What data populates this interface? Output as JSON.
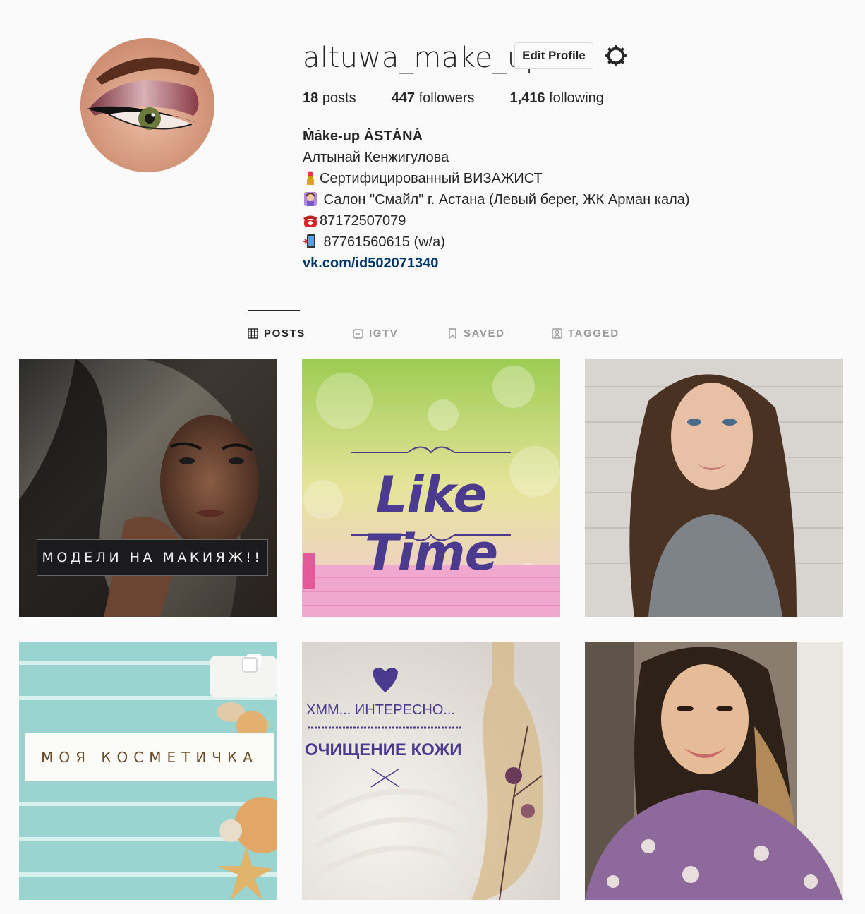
{
  "profile": {
    "username": "altuwa_make_up",
    "edit_label": "Edit Profile",
    "stats": {
      "posts_num": "18",
      "posts_label": "posts",
      "followers_num": "447",
      "followers_label": "followers",
      "following_num": "1,416",
      "following_label": "following"
    },
    "bio": {
      "name": "Ṁȧke-up ȦSTȦNȦ",
      "lines": [
        "Алтынай Кенжигулова",
        "Сертифицированный ВИЗАЖИСТ",
        " Салон \"Смайл\" г. Астана (Левый берег, ЖК Арман кала)",
        "87172507079",
        " 87761560615 (w/a)"
      ],
      "line_icons": [
        "lipstick-icon",
        "salon-woman-icon",
        "telephone-icon",
        "mobile-phone-icon"
      ],
      "link": "vk.com/id502071340"
    }
  },
  "tabs": [
    {
      "label": "POSTS",
      "icon": "grid-icon",
      "active": true
    },
    {
      "label": "IGTV",
      "icon": "igtv-icon",
      "active": false
    },
    {
      "label": "SAVED",
      "icon": "bookmark-icon",
      "active": false
    },
    {
      "label": "TAGGED",
      "icon": "tagged-icon",
      "active": false
    }
  ],
  "posts": [
    {
      "overlay_text": "МОДЕЛИ НА МАКИЯЖ!!"
    },
    {
      "overlay_text": "Like Time"
    },
    {
      "overlay_text": ""
    },
    {
      "overlay_text": "МОЯ КОСМЕТИЧКА",
      "multiple": true
    },
    {
      "overlay_text_1": "ХММ... ИНТЕРЕСНО...",
      "overlay_text_2": "ОЧИЩЕНИЕ КОЖИ"
    },
    {
      "overlay_text": ""
    }
  ],
  "colors": {
    "link": "#003569",
    "accent_purple": "#4a3b8f",
    "border": "#dbdbdb",
    "background": "#fafafa"
  }
}
